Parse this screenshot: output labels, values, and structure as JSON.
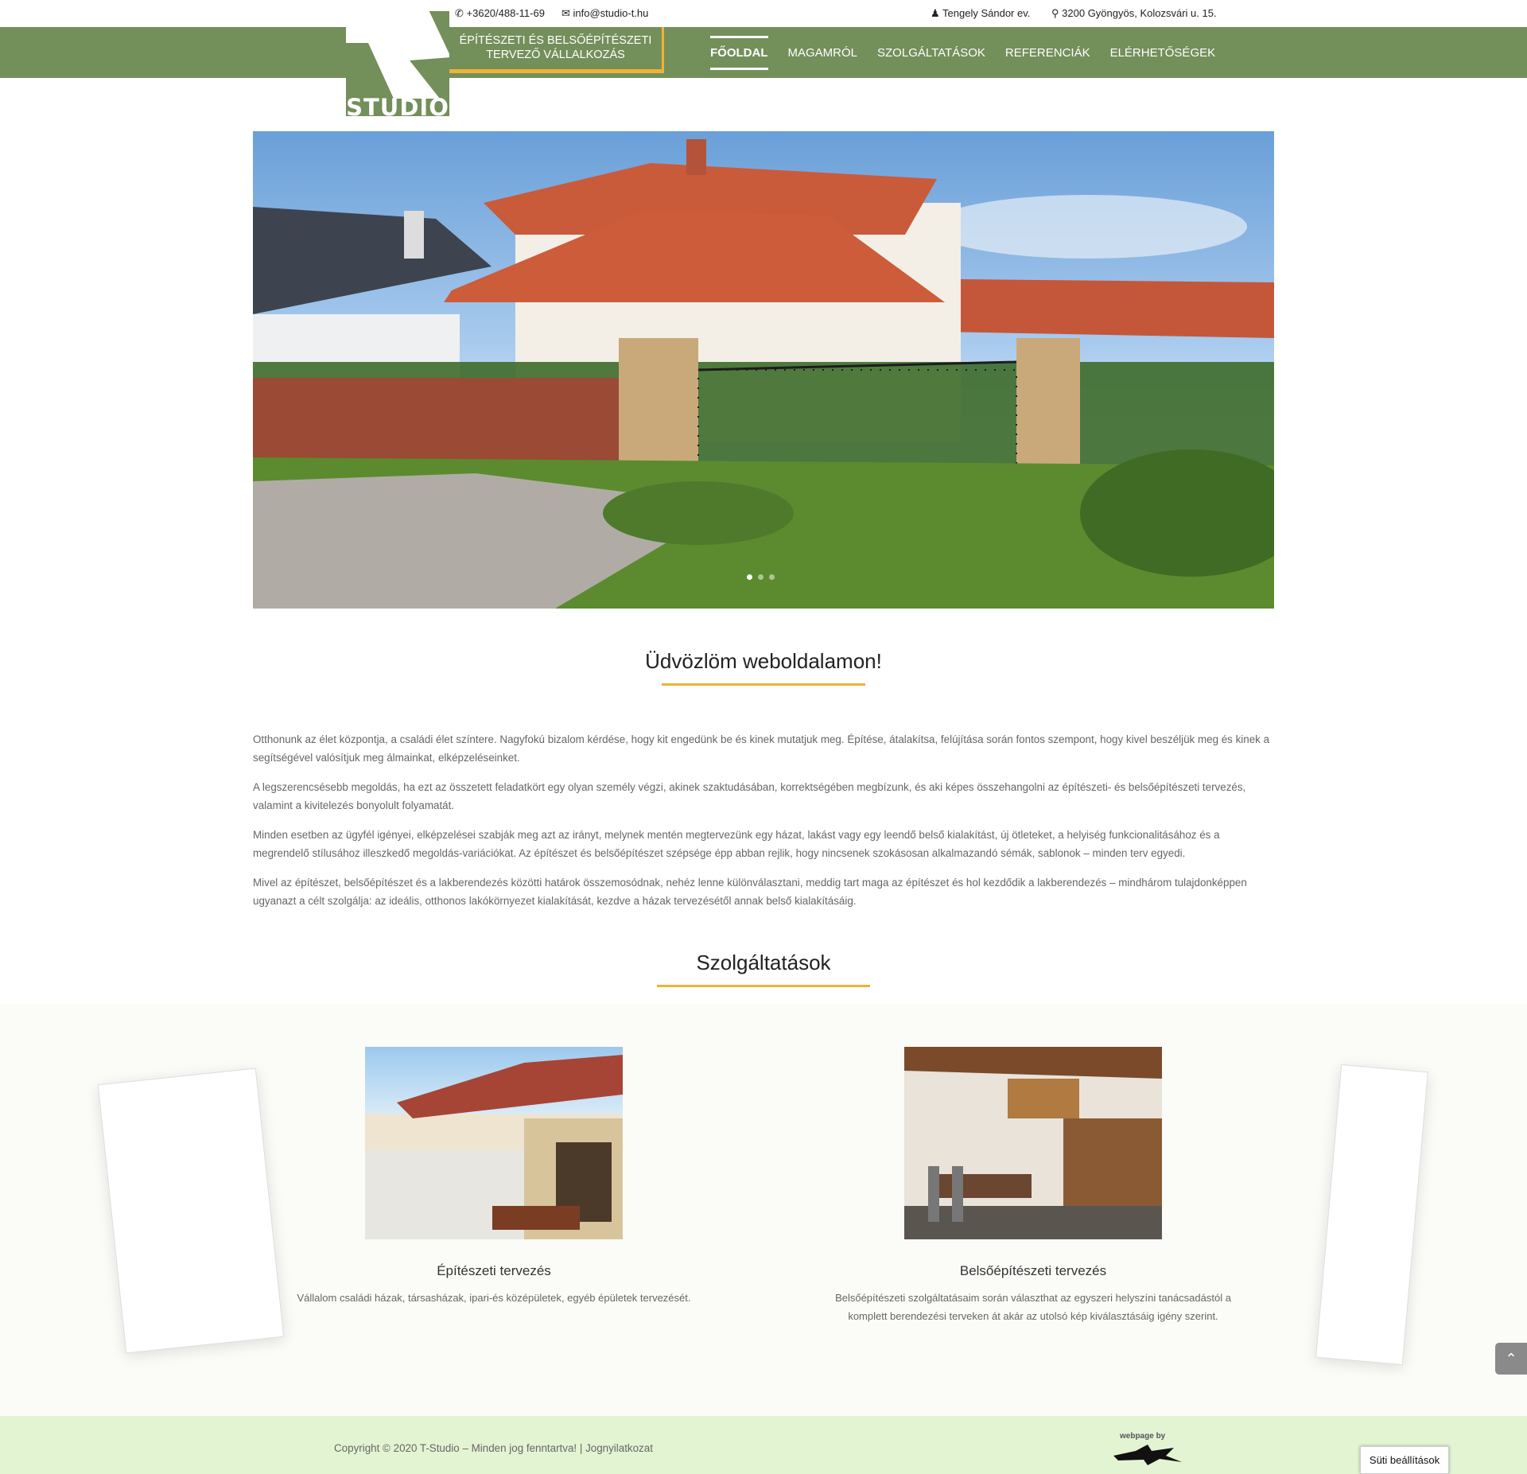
{
  "topbar": {
    "phone": "+3620/488-11-69",
    "email": "info@studio-t.hu",
    "owner": "Tengely Sándor ev.",
    "address": "3200 Gyöngyös, Kolozsvári u. 15."
  },
  "logo": {
    "text": "STUDIO"
  },
  "tagline": {
    "line1": "ÉPÍTÉSZETI ÉS BELSŐÉPÍTÉSZETI",
    "line2": "TERVEZŐ VÁLLALKOZÁS"
  },
  "nav": [
    {
      "label": "FŐOLDAL",
      "active": true
    },
    {
      "label": "MAGAMRÓL"
    },
    {
      "label": "SZOLGÁLTATÁSOK"
    },
    {
      "label": "REFERENCIÁK"
    },
    {
      "label": "ELÉRHETŐSÉGEK"
    }
  ],
  "slider": {
    "slides": 3,
    "active": 1
  },
  "welcome": {
    "title": "Üdvözlöm weboldalamon!",
    "paragraphs": [
      "Otthonunk az élet központja, a családi élet színtere. Nagyfokú bizalom kérdése, hogy kit engedünk be és kinek mutatjuk meg. Építése, átalakítsa, felújítása során fontos szempont, hogy kivel beszéljük meg és kinek a segítségével valósítjuk meg álmainkat, elképzeléseinket.",
      "A legszerencsésebb megoldás, ha ezt az összetett feladatkört egy olyan személy végzi, akinek szaktudásában, korrektségében megbízunk, és aki képes összehangolni az építészeti- és belsőépítészeti tervezés, valamint a kivitelezés bonyolult folyamatát.",
      "Minden esetben az ügyfél igényei, elképzelései szabják meg azt az irányt, melynek mentén megtervezünk egy házat, lakást vagy egy leendő belső kialakítást, új ötleteket, a helyiség funkcionalitásához és a megrendelő stílusához illeszkedő megoldás-variációkat. Az építészet és belsőépítészet szépsége épp abban rejlik, hogy nincsenek szokásosan alkalmazandó sémák, sablonok – minden terv egyedi.",
      "Mivel az építészet, belsőépítészet és a lakberendezés közötti határok összemosódnak, nehéz lenne különválasztani, meddig tart maga az építészet és hol kezdődik a lakberendezés – mindhárom tulajdonképpen ugyanazt a célt szolgálja: az ideális, otthonos lakókörnyezet kialakítását, kezdve a házak tervezésétől annak belső kialakításáig."
    ]
  },
  "services": {
    "title": "Szolgáltatások",
    "items": [
      {
        "title": "Építészeti tervezés",
        "text": "Vállalom családi házak, társasházak, ipari-és középületek, egyéb épületek tervezését."
      },
      {
        "title": "Belsőépítészeti tervezés",
        "text": "Belsőépítészeti szolgáltatásaim során választhat az egyszeri helyszíni tanácsadástól a komplett berendezési terveken át akár az utolsó kép kiválasztásáig igény szerint."
      }
    ]
  },
  "footer": {
    "copyright": "Copyright © 2020 T-Studio – Minden jog fenntartva! | ",
    "legal_link": "Jognyilatkozat",
    "credit": "webpage by",
    "cookie_button": "Süti beállítások"
  },
  "colors": {
    "brand_green": "#738f5a",
    "accent_orange": "#f2b134",
    "footer_bg": "#e3f4d3"
  }
}
